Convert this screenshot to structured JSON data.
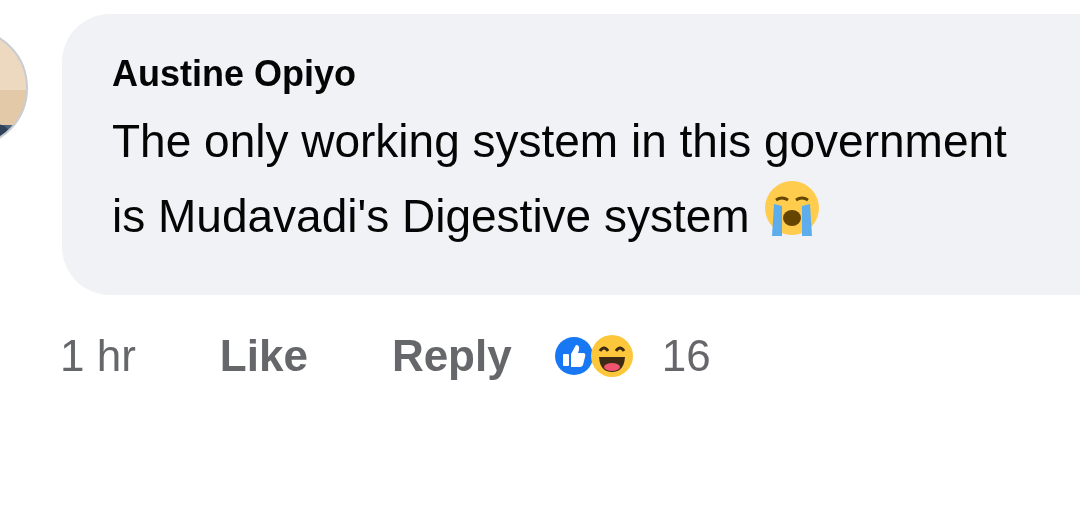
{
  "comment": {
    "author": "Austine Opiyo",
    "text": "The only working system in this government is Mudavadi's Digestive system"
  },
  "actions": {
    "time": "1 hr",
    "like": "Like",
    "reply": "Reply",
    "reaction_count": "16"
  }
}
